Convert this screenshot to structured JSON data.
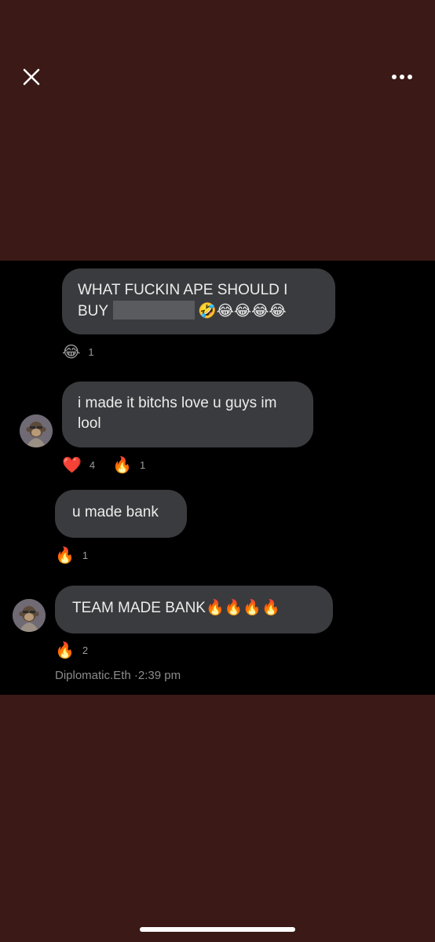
{
  "viewer": {
    "close_icon": "close-icon",
    "more_icon": "more-horizontal-icon"
  },
  "messages": [
    {
      "text_line1": "WHAT FUCKIN APE SHOULD I",
      "text_line2_prefix": "BUY",
      "text_line2_emojis": "🤣😂😂😂😂",
      "reactions": [
        {
          "emoji": "😂",
          "count": "1"
        }
      ]
    },
    {
      "text": "i made it bitchs love u guys im lool",
      "reactions": [
        {
          "emoji": "❤️",
          "count": "4"
        },
        {
          "emoji": "🔥",
          "count": "1"
        }
      ]
    },
    {
      "text": "u made bank",
      "reactions": [
        {
          "emoji": "🔥",
          "count": "1"
        }
      ]
    },
    {
      "text": "TEAM MADE BANK🔥🔥🔥🔥",
      "reactions": [
        {
          "emoji": "🔥",
          "count": "2"
        }
      ]
    }
  ],
  "footer": {
    "sender": "Diplomatic.Eth",
    "separator": "·",
    "time": "2:39 pm"
  },
  "colors": {
    "frame_background": "#3a1916",
    "chat_background": "#000000",
    "bubble": "#3a3b3e",
    "text": "#ececec",
    "meta_text": "#8c8c8c"
  }
}
